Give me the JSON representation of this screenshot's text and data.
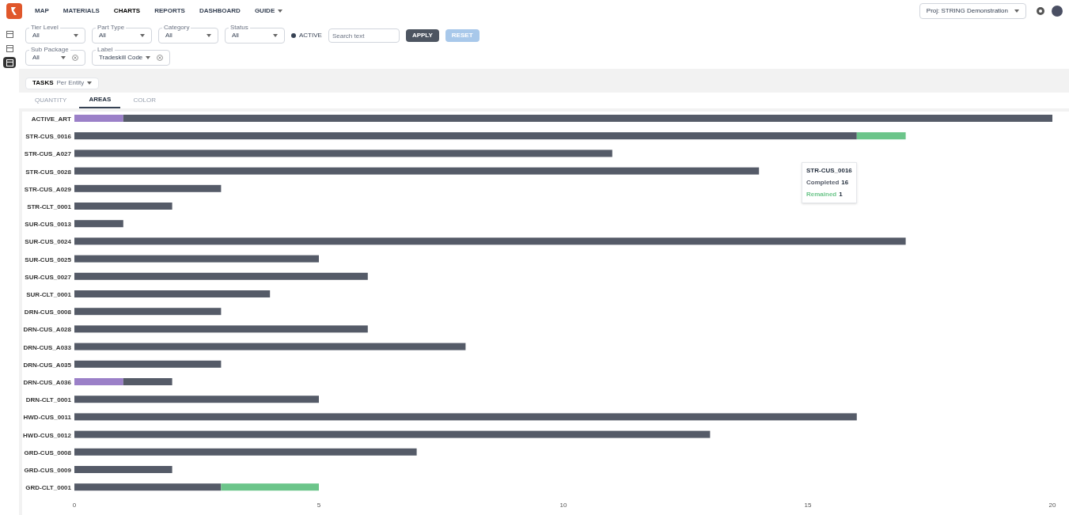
{
  "nav": {
    "items": [
      {
        "label": "MAP",
        "selected": false
      },
      {
        "label": "MATERIALS",
        "selected": false
      },
      {
        "label": "CHARTS",
        "selected": true
      },
      {
        "label": "REPORTS",
        "selected": false
      },
      {
        "label": "DASHBOARD",
        "selected": false
      },
      {
        "label": "GUIDE",
        "selected": false,
        "caret": true
      }
    ]
  },
  "project_select": {
    "value": "Proj: STRING Demonstration"
  },
  "sidebar": {
    "items": [
      {
        "selected": false
      },
      {
        "selected": false
      },
      {
        "selected": true
      }
    ]
  },
  "filters": [
    {
      "label": "Tier Level",
      "value": "All",
      "clearable": false
    },
    {
      "label": "Part Type",
      "value": "All",
      "clearable": false
    },
    {
      "label": "Category",
      "value": "All",
      "clearable": false
    },
    {
      "label": "Status",
      "value": "All",
      "clearable": false
    },
    {
      "label": "Sub Package",
      "value": "All",
      "clearable": true
    },
    {
      "label": "Label",
      "value": "Tradeskill Code",
      "clearable": true
    }
  ],
  "active_toggle": {
    "label": "ACTIVE",
    "checked": true
  },
  "search": {
    "placeholder": "Search text"
  },
  "buttons": [
    {
      "label": "APPLY",
      "kind": "primary"
    },
    {
      "label": "RESET",
      "kind": "secondary"
    }
  ],
  "chip": {
    "label": "TASKS",
    "value": "Per Entity"
  },
  "tabs": [
    {
      "label": "QUANTITY",
      "selected": false
    },
    {
      "label": "AREAS",
      "selected": true
    },
    {
      "label": "COLOR",
      "selected": false
    }
  ],
  "chart": {
    "chart_data": {
      "type": "bar",
      "orientation": "horizontal",
      "stacked": true,
      "categories": [
        "ACTIVE_ART",
        "STR-CUS_0016",
        "STR-CUS_A027",
        "STR-CUS_0028",
        "STR-CUS_A029",
        "STR-CLT_0001",
        "SUR-CUS_0013",
        "SUR-CUS_0024",
        "SUR-CUS_0025",
        "SUR-CUS_0027",
        "SUR-CLT_0001",
        "DRN-CUS_0008",
        "DRN-CUS_A028",
        "DRN-CUS_A033",
        "DRN-CUS_A035",
        "DRN-CUS_A036",
        "DRN-CLT_0001",
        "HWD-CUS_0011",
        "HWD-CUS_0012",
        "GRD-CUS_0008",
        "GRD-CUS_0009",
        "GRD-CLT_0001"
      ],
      "series": [
        {
          "color": "#9b80c8",
          "values": [
            1,
            0,
            0,
            0,
            0,
            0,
            0,
            0,
            0,
            0,
            0,
            0,
            0,
            0,
            0,
            1,
            0,
            0,
            0,
            0,
            0,
            0
          ]
        },
        {
          "name": "Completed",
          "color": "#555b68",
          "values": [
            19,
            16,
            11,
            14,
            3,
            2,
            1,
            17,
            5,
            6,
            4,
            3,
            6,
            8,
            3,
            1,
            5,
            16,
            13,
            7,
            2,
            3
          ]
        },
        {
          "name": "Remained",
          "color": "#6cc58a",
          "values": [
            0,
            1,
            0,
            0,
            0,
            0,
            0,
            0,
            0,
            0,
            0,
            0,
            0,
            0,
            0,
            0,
            0,
            0,
            0,
            0,
            0,
            2
          ]
        }
      ],
      "xlim": [
        0,
        20
      ],
      "xticks": [
        0,
        5,
        10,
        15,
        20
      ]
    },
    "tooltip": {
      "title": "STR-CUS_0016",
      "lines": [
        {
          "kind": "completed",
          "value": "16"
        },
        {
          "kind": "remained",
          "value": "1"
        }
      ]
    }
  }
}
